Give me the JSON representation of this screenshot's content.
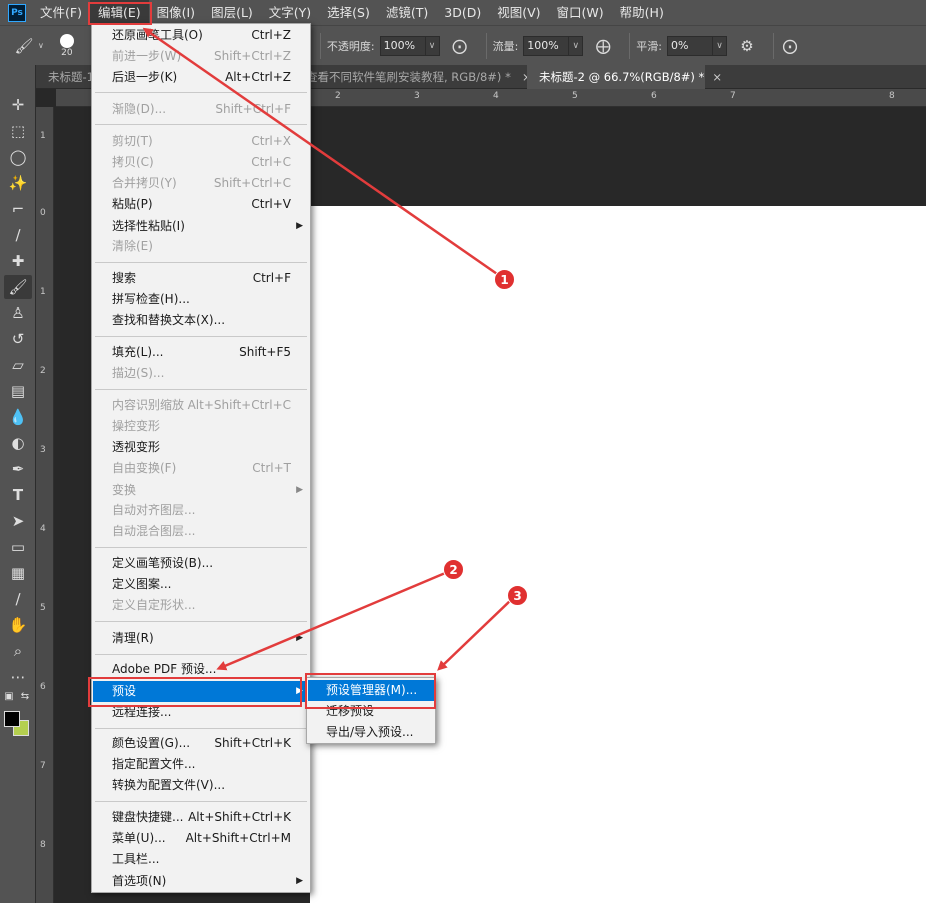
{
  "app": {
    "logo": "Ps"
  },
  "menubar": [
    {
      "label": "文件(F)"
    },
    {
      "label": "编辑(E)"
    },
    {
      "label": "图像(I)"
    },
    {
      "label": "图层(L)"
    },
    {
      "label": "文字(Y)"
    },
    {
      "label": "选择(S)"
    },
    {
      "label": "滤镜(T)"
    },
    {
      "label": "3D(D)"
    },
    {
      "label": "视图(V)"
    },
    {
      "label": "窗口(W)"
    },
    {
      "label": "帮助(H)"
    }
  ],
  "options": {
    "brush_size": "20",
    "opacity_label": "不透明度:",
    "opacity_value": "100%",
    "flow_label": "流量:",
    "flow_value": "100%",
    "smoothing_label": "平滑:",
    "smoothing_value": "0%"
  },
  "tabs": [
    {
      "label": "未标题-1"
    },
    {
      "label": "查看不同软件笔刷安装教程, RGB/8#) *"
    },
    {
      "label": "未标题-2 @ 66.7%(RGB/8#) *"
    }
  ],
  "ruler": {
    "top": [
      "2",
      "3",
      "4",
      "5",
      "6",
      "7",
      "8"
    ],
    "left": [
      "1",
      "0",
      "1",
      "2",
      "3",
      "4",
      "5",
      "6",
      "7",
      "8"
    ]
  },
  "edit_menu": {
    "items": [
      {
        "label": "还原画笔工具(O)",
        "shortcut": "Ctrl+Z"
      },
      {
        "label": "前进一步(W)",
        "shortcut": "Shift+Ctrl+Z",
        "disabled": true
      },
      {
        "label": "后退一步(K)",
        "shortcut": "Alt+Ctrl+Z"
      },
      {
        "label": "渐隐(D)...",
        "shortcut": "Shift+Ctrl+F",
        "disabled": true
      },
      {
        "label": "剪切(T)",
        "shortcut": "Ctrl+X",
        "disabled": true
      },
      {
        "label": "拷贝(C)",
        "shortcut": "Ctrl+C",
        "disabled": true
      },
      {
        "label": "合并拷贝(Y)",
        "shortcut": "Shift+Ctrl+C",
        "disabled": true
      },
      {
        "label": "粘贴(P)",
        "shortcut": "Ctrl+V"
      },
      {
        "label": "选择性粘贴(I)",
        "shortcut": "",
        "submenu": true
      },
      {
        "label": "清除(E)",
        "shortcut": "",
        "disabled": true
      },
      {
        "label": "搜索",
        "shortcut": "Ctrl+F"
      },
      {
        "label": "拼写检查(H)...",
        "shortcut": ""
      },
      {
        "label": "查找和替换文本(X)...",
        "shortcut": ""
      },
      {
        "label": "填充(L)...",
        "shortcut": "Shift+F5"
      },
      {
        "label": "描边(S)...",
        "shortcut": "",
        "disabled": true
      },
      {
        "label": "内容识别缩放",
        "shortcut": "Alt+Shift+Ctrl+C",
        "disabled": true
      },
      {
        "label": "操控变形",
        "shortcut": "",
        "disabled": true
      },
      {
        "label": "透视变形",
        "shortcut": ""
      },
      {
        "label": "自由变换(F)",
        "shortcut": "Ctrl+T",
        "disabled": true
      },
      {
        "label": "变换",
        "shortcut": "",
        "disabled": true,
        "submenu": true
      },
      {
        "label": "自动对齐图层...",
        "shortcut": "",
        "disabled": true
      },
      {
        "label": "自动混合图层...",
        "shortcut": "",
        "disabled": true
      },
      {
        "label": "定义画笔预设(B)...",
        "shortcut": ""
      },
      {
        "label": "定义图案...",
        "shortcut": ""
      },
      {
        "label": "定义自定形状...",
        "shortcut": "",
        "disabled": true
      },
      {
        "label": "清理(R)",
        "shortcut": "",
        "submenu": true
      },
      {
        "label": "Adobe PDF 预设...",
        "shortcut": ""
      },
      {
        "label": "预设",
        "shortcut": "",
        "submenu": true,
        "highlighted": true
      },
      {
        "label": "远程连接...",
        "shortcut": ""
      },
      {
        "label": "颜色设置(G)...",
        "shortcut": "Shift+Ctrl+K"
      },
      {
        "label": "指定配置文件...",
        "shortcut": ""
      },
      {
        "label": "转换为配置文件(V)...",
        "shortcut": ""
      },
      {
        "label": "键盘快捷键...",
        "shortcut": "Alt+Shift+Ctrl+K"
      },
      {
        "label": "菜单(U)...",
        "shortcut": "Alt+Shift+Ctrl+M"
      },
      {
        "label": "工具栏...",
        "shortcut": ""
      },
      {
        "label": "首选项(N)",
        "shortcut": "",
        "submenu": true
      }
    ]
  },
  "presets_submenu": {
    "items": [
      {
        "label": "预设管理器(M)...",
        "highlighted": true
      },
      {
        "label": "迁移预设"
      },
      {
        "label": "导出/导入预设..."
      }
    ]
  },
  "annotations": {
    "badge_1": "1",
    "badge_2": "2",
    "badge_3": "3",
    "color": "#e23c3c"
  },
  "colors": {
    "highlight": "#0078d7",
    "foreground_swatch": "#000000",
    "background_swatch": "#b4cf4f"
  }
}
